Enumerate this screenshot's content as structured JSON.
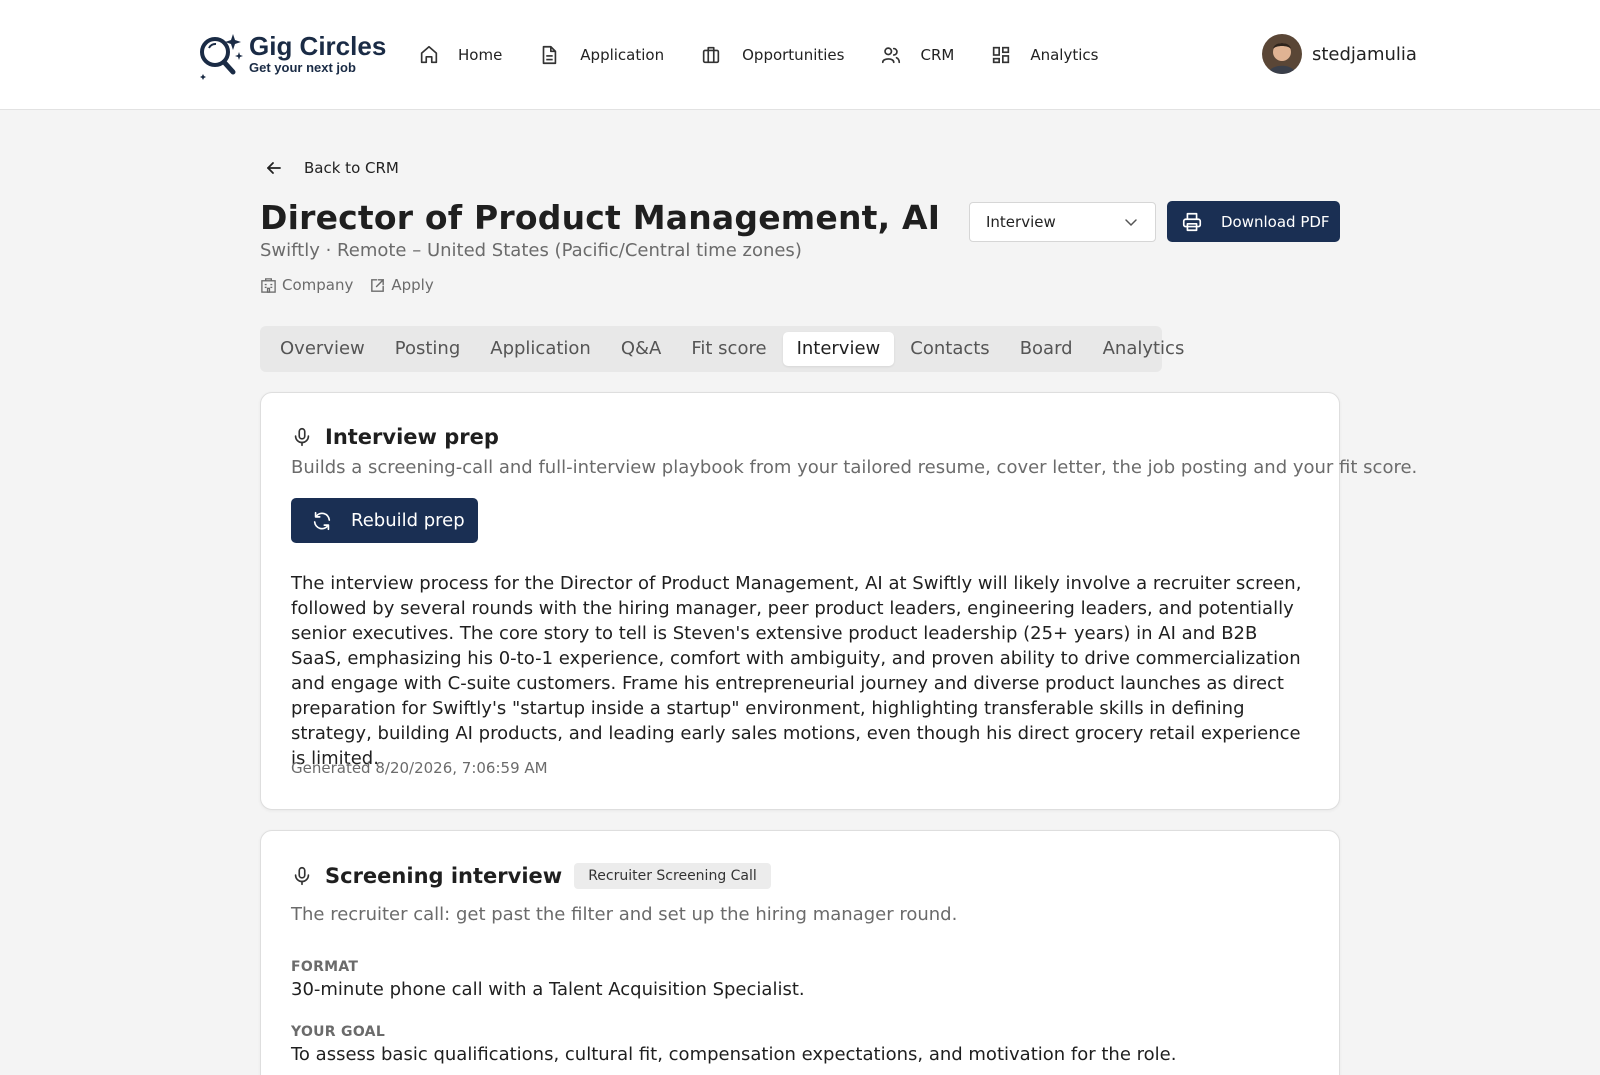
{
  "brand": {
    "name": "Gig Circles",
    "tagline": "Get your next job"
  },
  "nav": {
    "items": [
      {
        "label": "Home",
        "icon": "home-icon"
      },
      {
        "label": "Application",
        "icon": "document-icon"
      },
      {
        "label": "Opportunities",
        "icon": "briefcase-icon"
      },
      {
        "label": "CRM",
        "icon": "users-icon"
      },
      {
        "label": "Analytics",
        "icon": "dashboard-icon"
      }
    ]
  },
  "user": {
    "name": "stedjamulia"
  },
  "back": {
    "label": "Back to CRM"
  },
  "job": {
    "title": "Director of Product Management, AI",
    "subtitle": "Swiftly · Remote – United States (Pacific/Central time zones)",
    "company_link": "Company",
    "apply_link": "Apply"
  },
  "status": {
    "selected": "Interview"
  },
  "download": {
    "label": "Download PDF"
  },
  "tabs": [
    {
      "label": "Overview"
    },
    {
      "label": "Posting"
    },
    {
      "label": "Application"
    },
    {
      "label": "Q&A"
    },
    {
      "label": "Fit score"
    },
    {
      "label": "Interview",
      "active": true
    },
    {
      "label": "Contacts"
    },
    {
      "label": "Board"
    },
    {
      "label": "Analytics"
    }
  ],
  "prep": {
    "title": "Interview prep",
    "description": "Builds a screening-call and full-interview playbook from your tailored resume, cover letter, the job posting and your fit score.",
    "rebuild_label": "Rebuild prep",
    "summary": "The interview process for the Director of Product Management, AI at Swiftly will likely involve a recruiter screen, followed by several rounds with the hiring manager, peer product leaders, engineering leaders, and potentially senior executives. The core story to tell is Steven's extensive product leadership (25+ years) in AI and B2B SaaS, emphasizing his 0-to-1 experience, comfort with ambiguity, and proven ability to drive commercialization and engage with C-suite customers. Frame his entrepreneurial journey and diverse product launches as direct preparation for Swiftly's \"startup inside a startup\" environment, highlighting transferable skills in defining strategy, building AI products, and leading early sales motions, even though his direct grocery retail experience is limited.",
    "generated": "Generated 8/20/2026, 7:06:59 AM"
  },
  "screening": {
    "title": "Screening interview",
    "badge": "Recruiter Screening Call",
    "description": "The recruiter call: get past the filter and set up the hiring manager round.",
    "format_label": "FORMAT",
    "format_value": "30-minute phone call with a Talent Acquisition Specialist.",
    "goal_label": "YOUR GOAL",
    "goal_value": "To assess basic qualifications, cultural fit, compensation expectations, and motivation for the role."
  },
  "colors": {
    "primary": "#1a2f53",
    "background": "#f4f4f4",
    "muted_text": "#6b6b6b"
  }
}
